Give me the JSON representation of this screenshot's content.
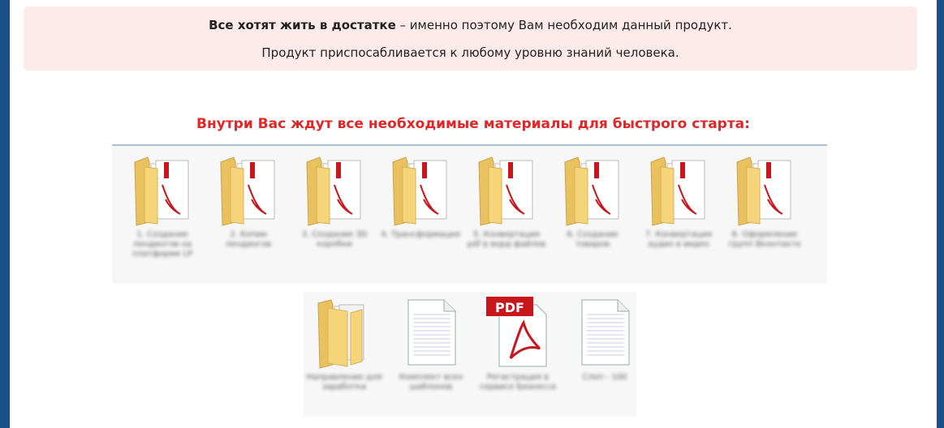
{
  "notice": {
    "line1_bold": "Все хотят жить в достатке",
    "line1_rest": " – именно поэтому Вам необходим данный продукт.",
    "line2": "Продукт приспосабливается к любому уровню знаний человека."
  },
  "heading": "Внутри Вас ждут все необходимые материалы для быстрого старта:",
  "folders": [
    {
      "label": "1. Создание лендингов на платформе LP",
      "icon": "pdf-folder-icon"
    },
    {
      "label": "2. Копии лендингов",
      "icon": "pdf-folder-icon"
    },
    {
      "label": "3. Создание 3D коробки",
      "icon": "pdf-folder-icon"
    },
    {
      "label": "4. Трансформация",
      "icon": "pdf-folder-icon"
    },
    {
      "label": "5. Конвертация pdf в ворд файлов",
      "icon": "pdf-folder-icon"
    },
    {
      "label": "6. Создание товаров",
      "icon": "pdf-folder-icon"
    },
    {
      "label": "7. Конвертация аудио в видео",
      "icon": "pdf-folder-icon"
    },
    {
      "label": "8. Оформление групп Вконтакте",
      "icon": "pdf-folder-icon"
    }
  ],
  "files": [
    {
      "label": "Направление для заработка",
      "icon": "folder-icon"
    },
    {
      "label": "Комплект всех шаблонов",
      "icon": "document-icon"
    },
    {
      "label": "Регистрация в сервисе Бизнесса",
      "icon": "pdf-file-icon"
    },
    {
      "label": "Слоп - 100",
      "icon": "document-icon"
    }
  ],
  "colors": {
    "background": "#1c4f86",
    "notice_bg": "#fdeaea",
    "heading": "#e02727",
    "folder": "#f6d57a",
    "pdf_red": "#c8161d"
  }
}
